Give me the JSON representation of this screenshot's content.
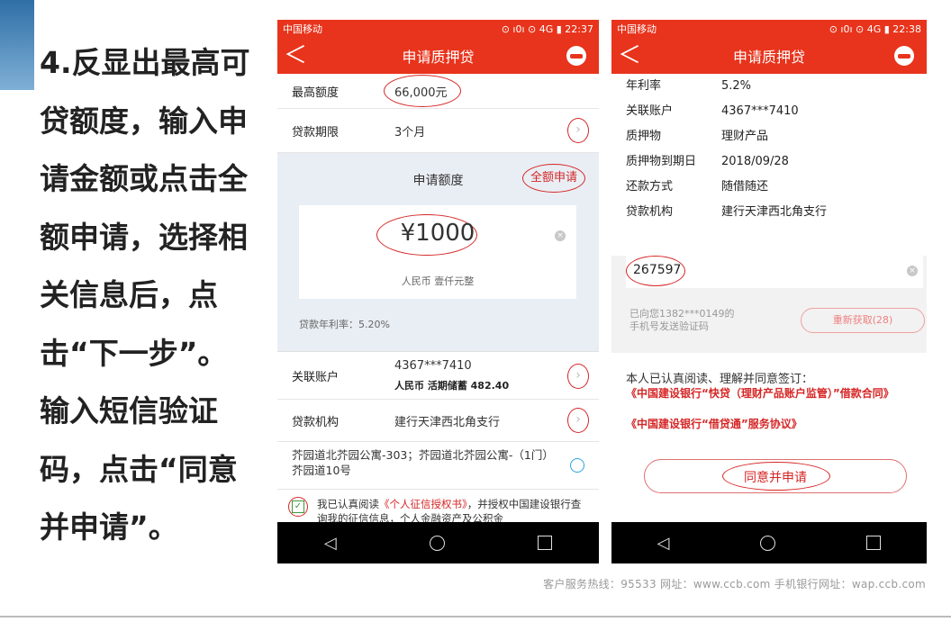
{
  "instructions": [
    "4.反显出最高可",
    "贷额度，输入申",
    "请金额或点击全",
    "额申请，选择相",
    "关信息后，点",
    "击“下一步”。",
    "输入短信验证",
    "码，点击“同意",
    "并申请”。"
  ],
  "footer": "客户服务热线：95533  网址：www.ccb.com  手机银行网址：wap.ccb.com",
  "screen1": {
    "status_left": "中国移动",
    "status_right": "⊙ ı0ı ⊙ 4G ▮ 22:37",
    "back": "＜",
    "title": "申请质押贷",
    "max_label": "最高额度",
    "max_value": "66,000元",
    "term_label": "贷款期限",
    "term_value": "3个月",
    "apply_label": "申请额度",
    "full_apply": "全额申请",
    "amount": "¥1000",
    "amount_words": "人民币 壹仟元整",
    "rate": "贷款年利率：5.20%",
    "account_label": "关联账户",
    "account_no": "4367***7410",
    "account_detail": "人民币 活期储蓄 482.40",
    "org_label": "贷款机构",
    "org_value": "建行天津西北角支行",
    "address": "芥园道北芥园公寓-303；芥园道北芥园公寓-（1门）芥园道10号",
    "consent_prefix": "我已认真阅读",
    "consent_link": "《个人征信授权书》",
    "consent_suffix": "，并授权中国建设银行查询我的征信信息，个人金融资产及公积金"
  },
  "screen2": {
    "status_left": "中国移动",
    "status_right": "⊙ ı0ı ⊙ 4G ▮ 22:38",
    "back": "＜",
    "title": "申请质押贷",
    "details": [
      {
        "label": "年利率",
        "value": "5.2%"
      },
      {
        "label": "关联账户",
        "value": "4367***7410"
      },
      {
        "label": "质押物",
        "value": "理财产品"
      },
      {
        "label": "质押物到期日",
        "value": "2018/09/28"
      },
      {
        "label": "还款方式",
        "value": "随借随还"
      },
      {
        "label": "贷款机构",
        "value": "建行天津西北角支行"
      }
    ],
    "sms_code": "267597",
    "sms_hint_1": "已向您1382***0149的",
    "sms_hint_2": "手机号发送验证码",
    "resend": "重新获取(28)",
    "agree_intro": "本人已认真阅读、理解并同意签订：",
    "agreement_1": "《中国建设银行“快贷（理财产品账户监管）”借款合同》",
    "agreement_2": "《中国建设银行“借贷通”服务协议》",
    "submit": "同意并申请"
  },
  "colors": {
    "brand_red": "#e8341c",
    "annotation_red": "#d62626"
  }
}
